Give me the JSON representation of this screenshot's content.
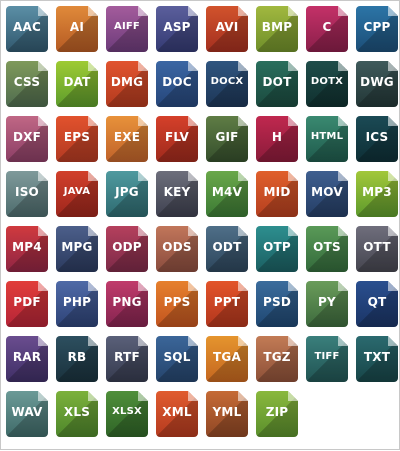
{
  "icons": [
    {
      "label": "AAC",
      "top": "#5b8fa6",
      "bottom": "#31586e"
    },
    {
      "label": "AI",
      "top": "#e08a3a",
      "bottom": "#b55a23"
    },
    {
      "label": "AIFF",
      "top": "#a45c9c",
      "bottom": "#6c3b7a"
    },
    {
      "label": "ASP",
      "top": "#5b5f9c",
      "bottom": "#343a73"
    },
    {
      "label": "AVI",
      "top": "#d2532c",
      "bottom": "#a42f1f"
    },
    {
      "label": "BMP",
      "top": "#a1b83f",
      "bottom": "#6f8f2a"
    },
    {
      "label": "C",
      "top": "#c43168",
      "bottom": "#8a1f4a"
    },
    {
      "label": "CPP",
      "top": "#2c75a7",
      "bottom": "#1c4e77"
    },
    {
      "label": "CSS",
      "top": "#7f9a5a",
      "bottom": "#4f6c4f"
    },
    {
      "label": "DAT",
      "top": "#9ecb33",
      "bottom": "#5d9c2c"
    },
    {
      "label": "DMG",
      "top": "#e1542f",
      "bottom": "#b33a1e"
    },
    {
      "label": "DOC",
      "top": "#3b66a3",
      "bottom": "#26467a"
    },
    {
      "label": "DOCX",
      "top": "#2f557f",
      "bottom": "#1d3657"
    },
    {
      "label": "DOT",
      "top": "#2a6f5d",
      "bottom": "#1b4a3f"
    },
    {
      "label": "DOTX",
      "top": "#1f4d4a",
      "bottom": "#10302f"
    },
    {
      "label": "DWG",
      "top": "#3f5a5b",
      "bottom": "#233737"
    },
    {
      "label": "DXF",
      "top": "#c06785",
      "bottom": "#8b3e65"
    },
    {
      "label": "EPS",
      "top": "#e2522d",
      "bottom": "#b23a22"
    },
    {
      "label": "EXE",
      "top": "#e8923a",
      "bottom": "#c0622a"
    },
    {
      "label": "FLV",
      "top": "#d5402a",
      "bottom": "#9f2a1c"
    },
    {
      "label": "GIF",
      "top": "#5f7d45",
      "bottom": "#354f2c"
    },
    {
      "label": "H",
      "top": "#c0284f",
      "bottom": "#8a1b3a"
    },
    {
      "label": "HTML",
      "top": "#3a8a71",
      "bottom": "#1f5a4c"
    },
    {
      "label": "ICS",
      "top": "#1b4a55",
      "bottom": "#0e2f36"
    },
    {
      "label": "ISO",
      "top": "#7f9a9b",
      "bottom": "#4d6b6d"
    },
    {
      "label": "JAVA",
      "top": "#d1402b",
      "bottom": "#9e261c"
    },
    {
      "label": "JPG",
      "top": "#4f9a9f",
      "bottom": "#2e6a70"
    },
    {
      "label": "KEY",
      "top": "#6d6e7b",
      "bottom": "#3f4150"
    },
    {
      "label": "M4V",
      "top": "#6aa84a",
      "bottom": "#3b7a34"
    },
    {
      "label": "MID",
      "top": "#e0602c",
      "bottom": "#b53f1f"
    },
    {
      "label": "MOV",
      "top": "#3f5f8f",
      "bottom": "#253e66"
    },
    {
      "label": "MP3",
      "top": "#a2c83a",
      "bottom": "#5d9a2c"
    },
    {
      "label": "MP4",
      "top": "#d03a3e",
      "bottom": "#8f2544"
    },
    {
      "label": "MPG",
      "top": "#4c5f8a",
      "bottom": "#2b3a5e"
    },
    {
      "label": "ODP",
      "top": "#b5405d",
      "bottom": "#7c2a48"
    },
    {
      "label": "ODS",
      "top": "#c1765a",
      "bottom": "#8a4c3e"
    },
    {
      "label": "ODT",
      "top": "#4f6f88",
      "bottom": "#2d465c"
    },
    {
      "label": "OTP",
      "top": "#2d8f8f",
      "bottom": "#1b5f62"
    },
    {
      "label": "OTS",
      "top": "#5a9a58",
      "bottom": "#336a3b"
    },
    {
      "label": "OTT",
      "top": "#6f6e7c",
      "bottom": "#45454f"
    },
    {
      "label": "PDF",
      "top": "#e13e3a",
      "bottom": "#b52437"
    },
    {
      "label": "PHP",
      "top": "#4f6aa7",
      "bottom": "#2e4377"
    },
    {
      "label": "PNG",
      "top": "#c03b6b",
      "bottom": "#852450"
    },
    {
      "label": "PPS",
      "top": "#e6802d",
      "bottom": "#c2541f"
    },
    {
      "label": "PPT",
      "top": "#e3542a",
      "bottom": "#b2361d"
    },
    {
      "label": "PSD",
      "top": "#3b6c9c",
      "bottom": "#1f4772"
    },
    {
      "label": "PY",
      "top": "#6a9c5a",
      "bottom": "#3d6a3d"
    },
    {
      "label": "QT",
      "top": "#2a4f8f",
      "bottom": "#1b3566"
    },
    {
      "label": "RAR",
      "top": "#6a4d8f",
      "bottom": "#3f2f66"
    },
    {
      "label": "RB",
      "top": "#2d4f5f",
      "bottom": "#1a323d"
    },
    {
      "label": "RTF",
      "top": "#5a6079",
      "bottom": "#363b4f"
    },
    {
      "label": "SQL",
      "top": "#3b6699",
      "bottom": "#25446c"
    },
    {
      "label": "TGA",
      "top": "#e5952e",
      "bottom": "#c5661f"
    },
    {
      "label": "TGZ",
      "top": "#c27b55",
      "bottom": "#8d5038"
    },
    {
      "label": "TIFF",
      "top": "#3a7f7c",
      "bottom": "#215453"
    },
    {
      "label": "TXT",
      "top": "#2b6a6f",
      "bottom": "#174548"
    },
    {
      "label": "WAV",
      "top": "#6b9a97",
      "bottom": "#3f6a69"
    },
    {
      "label": "XLS",
      "top": "#7cb13b",
      "bottom": "#4e862b"
    },
    {
      "label": "XLSX",
      "top": "#4f8f3a",
      "bottom": "#2f6427"
    },
    {
      "label": "XML",
      "top": "#e05c2f",
      "bottom": "#b53a1f"
    },
    {
      "label": "YML",
      "top": "#c56a35",
      "bottom": "#8f4725"
    },
    {
      "label": "ZIP",
      "top": "#8ab83d",
      "bottom": "#5a8f2c"
    }
  ]
}
